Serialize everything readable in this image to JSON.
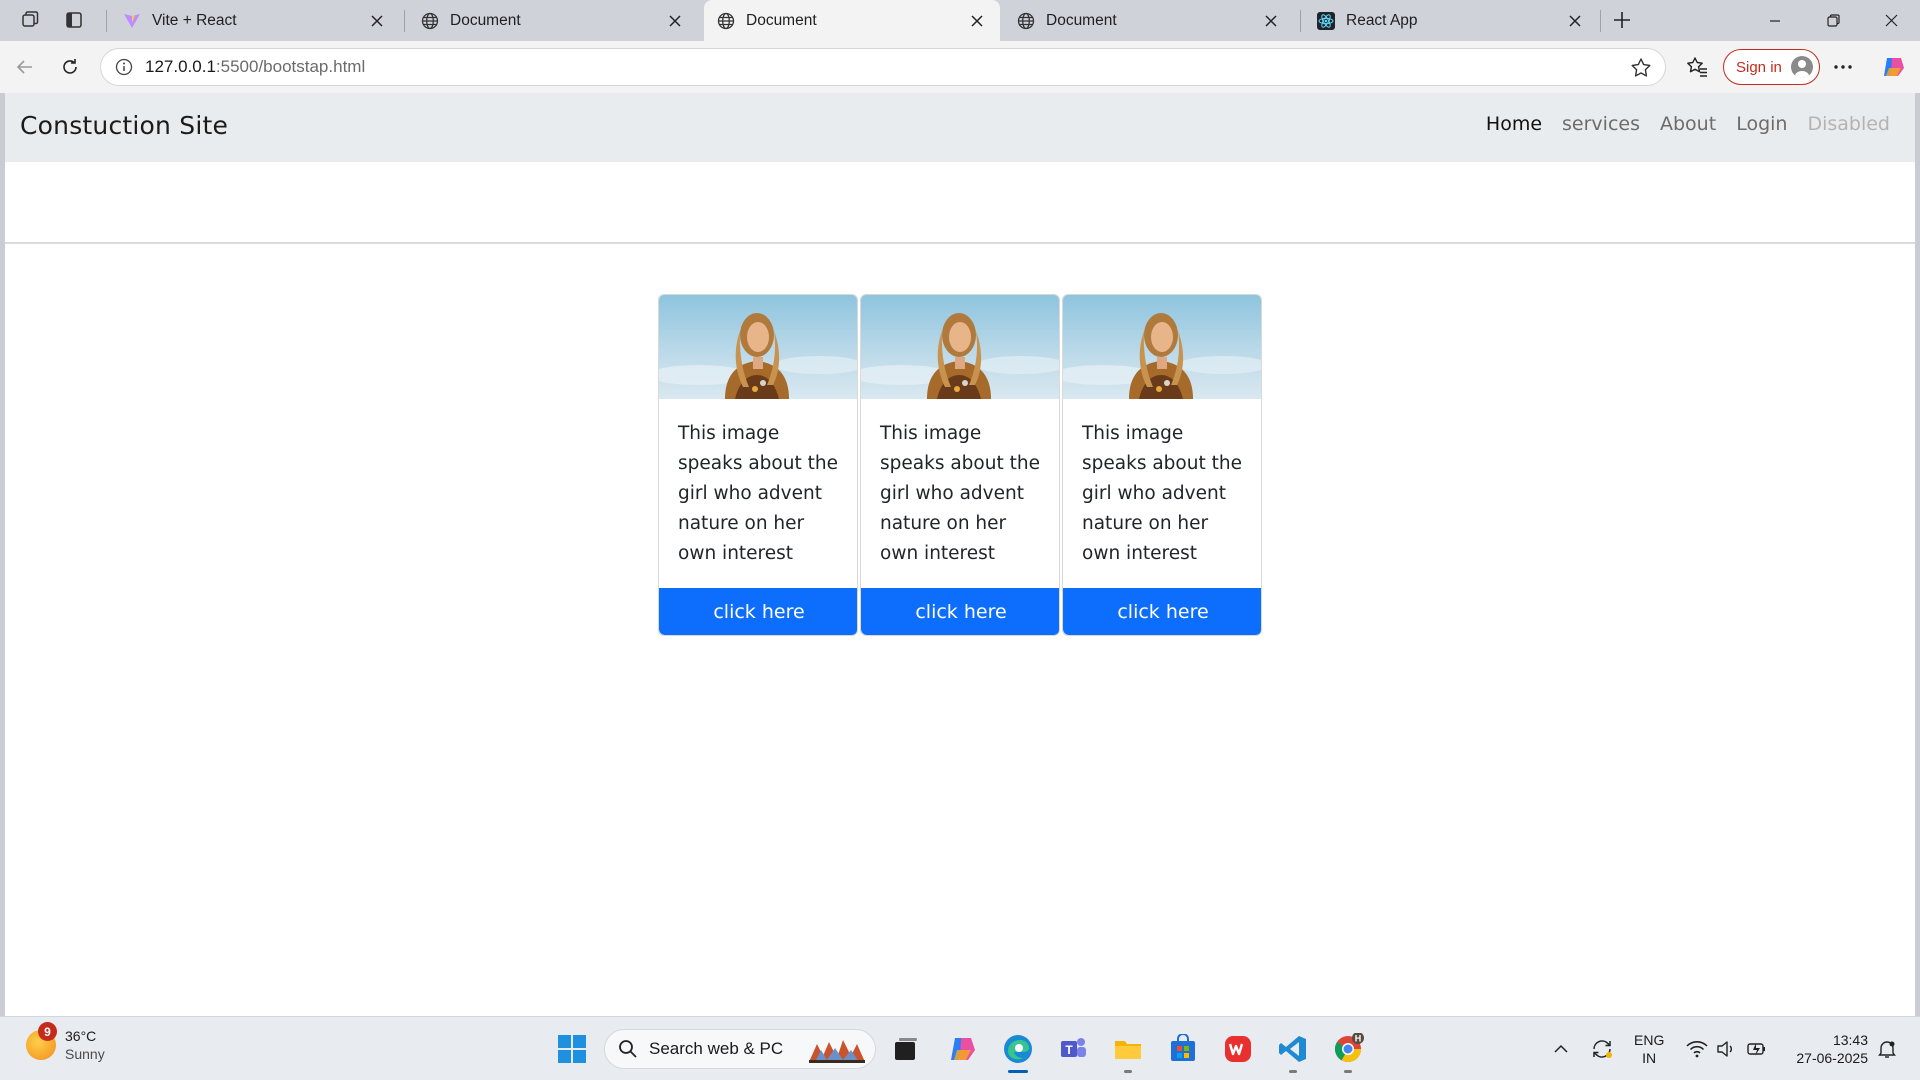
{
  "browser": {
    "tabs": [
      {
        "title": "Vite + React",
        "icon": "vite-icon",
        "active": false
      },
      {
        "title": "Document",
        "icon": "globe-icon",
        "active": false
      },
      {
        "title": "Document",
        "icon": "globe-icon",
        "active": true
      },
      {
        "title": "Document",
        "icon": "globe-icon",
        "active": false
      },
      {
        "title": "React App",
        "icon": "react-icon",
        "active": false
      }
    ],
    "url_host": "127.0.0.1",
    "url_rest": ":5500/bootstap.html",
    "signin_label": "Sign in",
    "accent": "#c42b1c"
  },
  "page": {
    "brand": "Constuction Site",
    "nav": [
      {
        "label": "Home",
        "state": "active"
      },
      {
        "label": "services",
        "state": "normal"
      },
      {
        "label": "About",
        "state": "normal"
      },
      {
        "label": "Login",
        "state": "normal"
      },
      {
        "label": "Disabled",
        "state": "disabled"
      }
    ],
    "cards": [
      {
        "text": "This image speaks about the girl who advent nature on her own interest",
        "button": "click here"
      },
      {
        "text": "This image speaks about the girl who advent nature on her own interest",
        "button": "click here"
      },
      {
        "text": "This image speaks about the girl who advent nature on her own interest",
        "button": "click here"
      }
    ],
    "button_color": "#0d6efd",
    "navbar_color": "#e9ecef"
  },
  "taskbar": {
    "weather": {
      "temp": "36°C",
      "condition": "Sunny",
      "badge": "9"
    },
    "search_placeholder": "Search web & PC",
    "apps": [
      "task-view-icon",
      "copilot-icon",
      "edge-icon",
      "teams-icon",
      "file-explorer-icon",
      "store-icon",
      "wps-office-icon",
      "vscode-icon",
      "chrome-icon"
    ],
    "lang_line1": "ENG",
    "lang_line2": "IN",
    "time": "13:43",
    "date": "27-06-2025"
  }
}
